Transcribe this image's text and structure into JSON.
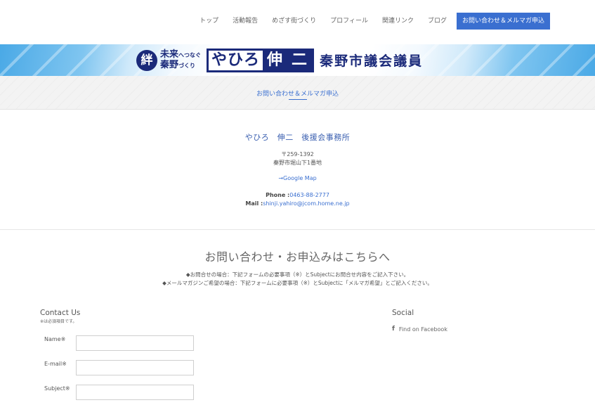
{
  "nav": {
    "items": [
      "トップ",
      "活動報告",
      "めざす街づくり",
      "プロフィール",
      "関連リンク",
      "ブログ"
    ],
    "active_label": "お問い合わせ＆メルマガ申込"
  },
  "banner": {
    "kizuna": "絆",
    "slogan_line1_main": "未来",
    "slogan_line1_small": "へつなぐ",
    "slogan_line2_main": "秦野",
    "slogan_line2_small": "づくり",
    "name_part1": "やひろ",
    "name_part2": "伸",
    "name_part3": "二",
    "title": "秦野市議会議員"
  },
  "page_title": "お問い合わせ＆メルマガ申込",
  "office": {
    "name": "やひろ　伸二　後援会事務所",
    "zip": "〒259-1392",
    "address": "秦野市堀山下1番地",
    "map_link": "→Google Map",
    "phone_label": "Phone :",
    "phone": "0463-88-2777",
    "mail_label": "Mail :",
    "mail": "shinji.yahiro@jcom.home.ne.jp"
  },
  "contact": {
    "heading": "お問い合わせ・お申込みはこちらへ",
    "note1": "◆お問合せの場合：下記フォームの必要事項（※）とSubjectにお問合せ内容をご記入下さい。",
    "note2": "◆メールマガジンご希望の場合：下記フォームに必要事項（※）とSubjectに「メルマガ希望」とご記入ください。"
  },
  "form": {
    "title": "Contact Us",
    "required_note": "※は必須項目です。",
    "fields": [
      {
        "label": "Name※",
        "value": ""
      },
      {
        "label": "E-mail※",
        "value": ""
      },
      {
        "label": "Subject※",
        "value": ""
      }
    ]
  },
  "social": {
    "title": "Social",
    "icon": "facebook-icon",
    "link_label": "Find on Facebook"
  },
  "colors": {
    "accent": "#3a6fd0",
    "brand_navy": "#1b2a7a"
  }
}
